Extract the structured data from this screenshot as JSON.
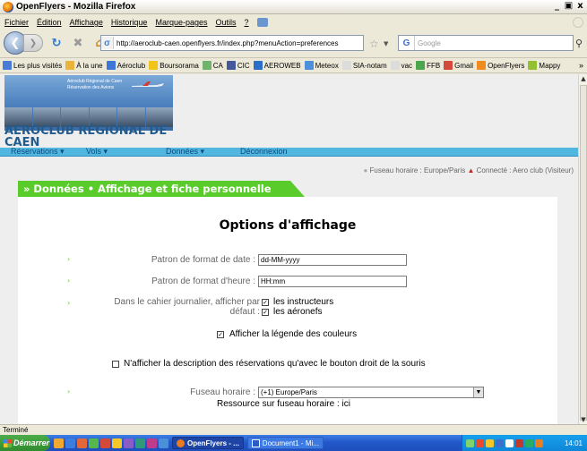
{
  "window": {
    "title": "OpenFlyers - Mozilla Firefox",
    "controls": [
      "_",
      "̶",
      "x"
    ]
  },
  "menu": [
    "Fichier",
    "Édition",
    "Affichage",
    "Historique",
    "Marque-pages",
    "Outils",
    "?"
  ],
  "toolbar": {
    "url": "http://aeroclub-caen.openflyers.fr/index.php?menuAction=preferences",
    "search_placeholder": "Google"
  },
  "bookmarks": [
    {
      "label": "Les plus visités",
      "color": "#4a7bd6"
    },
    {
      "label": "À la une",
      "color": "#e8b43c"
    },
    {
      "label": "Aéroclub",
      "color": "#3d76d6"
    },
    {
      "label": "Boursorama",
      "color": "#f0c419"
    },
    {
      "label": "CA",
      "color": "#6fb36c"
    },
    {
      "label": "CIC",
      "color": "#445a9a"
    },
    {
      "label": "AEROWEB",
      "color": "#2b6fcb"
    },
    {
      "label": "Meteox",
      "color": "#4c90db"
    },
    {
      "label": "SIA-notam",
      "color": "#dcdcdc"
    },
    {
      "label": "vac",
      "color": "#dcdcdc"
    },
    {
      "label": "FFB",
      "color": "#4ca64c"
    },
    {
      "label": "Gmail",
      "color": "#d34a3a"
    },
    {
      "label": "OpenFlyers",
      "color": "#f08c1f"
    },
    {
      "label": "Mappy",
      "color": "#93c131"
    }
  ],
  "site": {
    "banner_lines": [
      "Aéroclub Régional de Caen",
      "Réservation des Avions"
    ],
    "org_name": "AÉROCLUB RÉGIONAL DE CAEN",
    "nav": [
      "Réservations",
      "Vols",
      "Données",
      "Déconnexion"
    ],
    "timezone_status": "Fuseau horaire : Europe/Paris",
    "connected_status": "Connecté : Aero club  (Visiteur)",
    "section_title": "» Données • Affichage et fiche personnelle"
  },
  "form": {
    "heading": "Options d'affichage",
    "date_format_label": "Patron de format de date :",
    "date_format_value": "dd-MM-yyyy",
    "time_format_label": "Patron de format d'heure :",
    "time_format_value": "HH:mm",
    "journal_label_1": "Dans le cahier journalier, afficher par",
    "journal_label_2": "défaut :",
    "journal_opt_instructeurs": "les instructeurs",
    "journal_opt_aeronefs": "les aéronefs",
    "legend_label": "Afficher la légende des couleurs",
    "desc_right_click_label": "N'afficher la description des réservations qu'avec le bouton droit de la souris",
    "timezone_label": "Fuseau horaire :",
    "timezone_value": "(+1) Europe/Paris",
    "timezone_resource": "Ressource sur fuseau horaire : ici"
  },
  "statusbar": "Terminé",
  "taskbar": {
    "start": "Démarrer",
    "tasks": [
      {
        "label": "OpenFlyers - ...",
        "active": true
      },
      {
        "label": "Document1 - Mi...",
        "active": false
      }
    ],
    "clock": "14:01"
  }
}
